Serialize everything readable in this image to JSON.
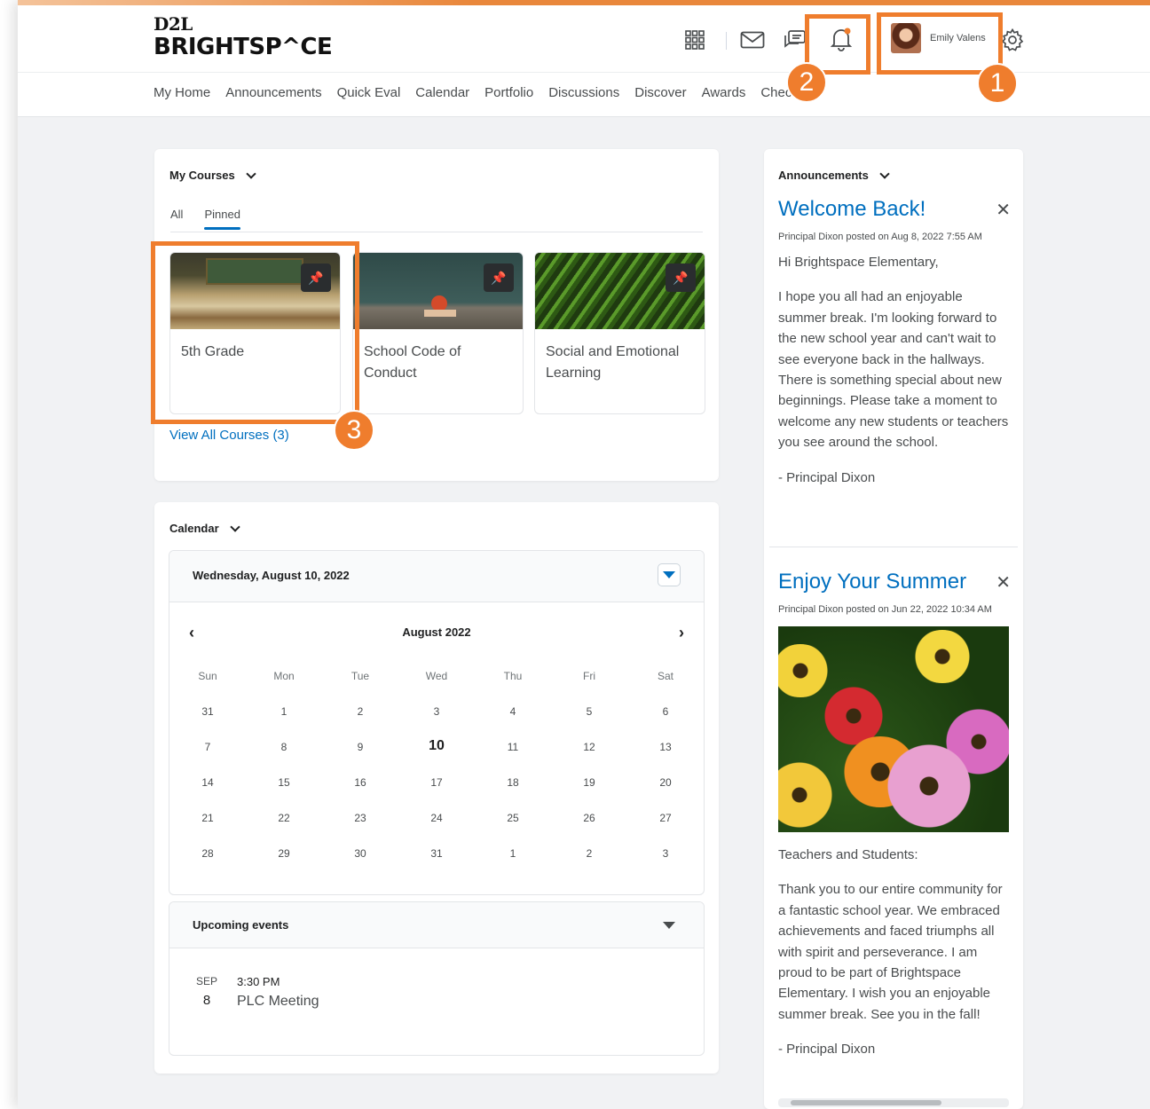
{
  "brand": {
    "top": "D2L",
    "bottom": "BRIGHTSP^CE"
  },
  "header": {
    "user_name": "Emily Valens"
  },
  "nav": [
    "My Home",
    "Announcements",
    "Quick Eval",
    "Calendar",
    "Portfolio",
    "Discussions",
    "Discover",
    "Awards",
    "Checklist"
  ],
  "callouts": [
    "1",
    "2",
    "3"
  ],
  "my_courses": {
    "title": "My Courses",
    "tabs": [
      "All",
      "Pinned"
    ],
    "active_tab": "Pinned",
    "courses": [
      {
        "name": "5th Grade"
      },
      {
        "name": "School Code of Conduct"
      },
      {
        "name": "Social and Emotional Learning"
      }
    ],
    "view_all": "View All Courses (3)"
  },
  "calendar": {
    "title": "Calendar",
    "selected_date": "Wednesday, August 10, 2022",
    "month": "August 2022",
    "weekdays": [
      "Sun",
      "Mon",
      "Tue",
      "Wed",
      "Thu",
      "Fri",
      "Sat"
    ],
    "weeks": [
      [
        "31",
        "1",
        "2",
        "3",
        "4",
        "5",
        "6"
      ],
      [
        "7",
        "8",
        "9",
        "10",
        "11",
        "12",
        "13"
      ],
      [
        "14",
        "15",
        "16",
        "17",
        "18",
        "19",
        "20"
      ],
      [
        "21",
        "22",
        "23",
        "24",
        "25",
        "26",
        "27"
      ],
      [
        "28",
        "29",
        "30",
        "31",
        "1",
        "2",
        "3"
      ]
    ],
    "today": "10",
    "upcoming_title": "Upcoming events",
    "events": [
      {
        "month": "SEP",
        "day": "8",
        "time": "3:30 PM",
        "title": "PLC Meeting"
      }
    ]
  },
  "announcements": {
    "title": "Announcements",
    "items": [
      {
        "title": "Welcome Back!",
        "meta": "Principal Dixon posted on Aug 8, 2022 7:55 AM",
        "greeting": "Hi Brightspace Elementary,",
        "body": "I hope you all had an enjoyable summer break. I'm looking forward to the new school year and can't wait to see everyone back in the hallways. There is something special about new beginnings. Please take a moment to welcome any new students or teachers you see around the school.",
        "signoff": "- Principal Dixon"
      },
      {
        "title": "Enjoy Your Summer",
        "meta": "Principal Dixon posted on Jun 22, 2022 10:34 AM",
        "greeting": "Teachers and Students:",
        "body": "Thank you to our entire community for a fantastic school year. We embraced achievements and faced triumphs all with spirit and perseverance. I am proud to be part of Brightspace Elementary. I wish you an enjoyable summer break. See you in the fall!",
        "signoff": "- Principal Dixon"
      }
    ]
  },
  "colors": {
    "accent": "#006fbf",
    "callout": "#ef7d2d"
  }
}
